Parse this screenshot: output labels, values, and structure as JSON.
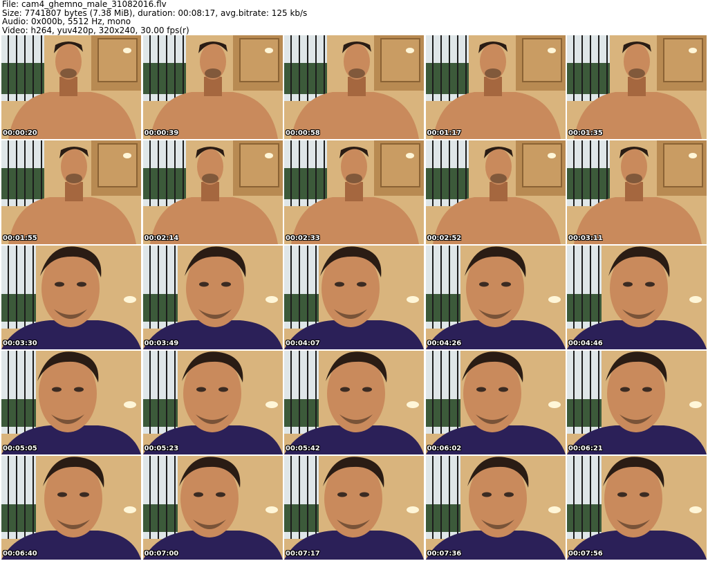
{
  "header": {
    "line1": "File: cam4_ghemno_male_31082016.flv",
    "line2": "Size: 7741807 bytes (7.38 MiB), duration: 00:08:17, avg.bitrate: 125 kb/s",
    "line3": "Audio: 0x000b, 5512 Hz, mono",
    "line4": "Video: h264, yuv420p, 320x240, 30.00 fps(r)"
  },
  "thumbnails": [
    {
      "timestamp": "00:00:20",
      "scene": "shirtless"
    },
    {
      "timestamp": "00:00:39",
      "scene": "shirtless"
    },
    {
      "timestamp": "00:00:58",
      "scene": "shirtless"
    },
    {
      "timestamp": "00:01:17",
      "scene": "shirtless"
    },
    {
      "timestamp": "00:01:35",
      "scene": "shirtless"
    },
    {
      "timestamp": "00:01:55",
      "scene": "shirtless"
    },
    {
      "timestamp": "00:02:14",
      "scene": "shirtless"
    },
    {
      "timestamp": "00:02:33",
      "scene": "shirtless"
    },
    {
      "timestamp": "00:02:52",
      "scene": "shirtless"
    },
    {
      "timestamp": "00:03:11",
      "scene": "shirtless"
    },
    {
      "timestamp": "00:03:30",
      "scene": "closeup"
    },
    {
      "timestamp": "00:03:49",
      "scene": "closeup"
    },
    {
      "timestamp": "00:04:07",
      "scene": "closeup"
    },
    {
      "timestamp": "00:04:26",
      "scene": "closeup"
    },
    {
      "timestamp": "00:04:46",
      "scene": "closeup"
    },
    {
      "timestamp": "00:05:05",
      "scene": "closeup"
    },
    {
      "timestamp": "00:05:23",
      "scene": "closeup"
    },
    {
      "timestamp": "00:05:42",
      "scene": "closeup"
    },
    {
      "timestamp": "00:06:02",
      "scene": "closeup"
    },
    {
      "timestamp": "00:06:21",
      "scene": "closeup"
    },
    {
      "timestamp": "00:06:40",
      "scene": "closeup"
    },
    {
      "timestamp": "00:07:00",
      "scene": "closeup"
    },
    {
      "timestamp": "00:07:17",
      "scene": "closeup"
    },
    {
      "timestamp": "00:07:36",
      "scene": "closeup"
    },
    {
      "timestamp": "00:07:56",
      "scene": "closeup"
    }
  ],
  "colors": {
    "skin": "#c98a5c",
    "skin_shadow": "#a5673f",
    "hair": "#2a1c14",
    "wall": "#d9b47d",
    "cabinet": "#b88a52",
    "window": "#dfe6e8",
    "foliage": "#3c5a3a",
    "shirt": "#2b2058",
    "lamp": "#fff6d8",
    "timestamp_text": "#ffffff"
  }
}
